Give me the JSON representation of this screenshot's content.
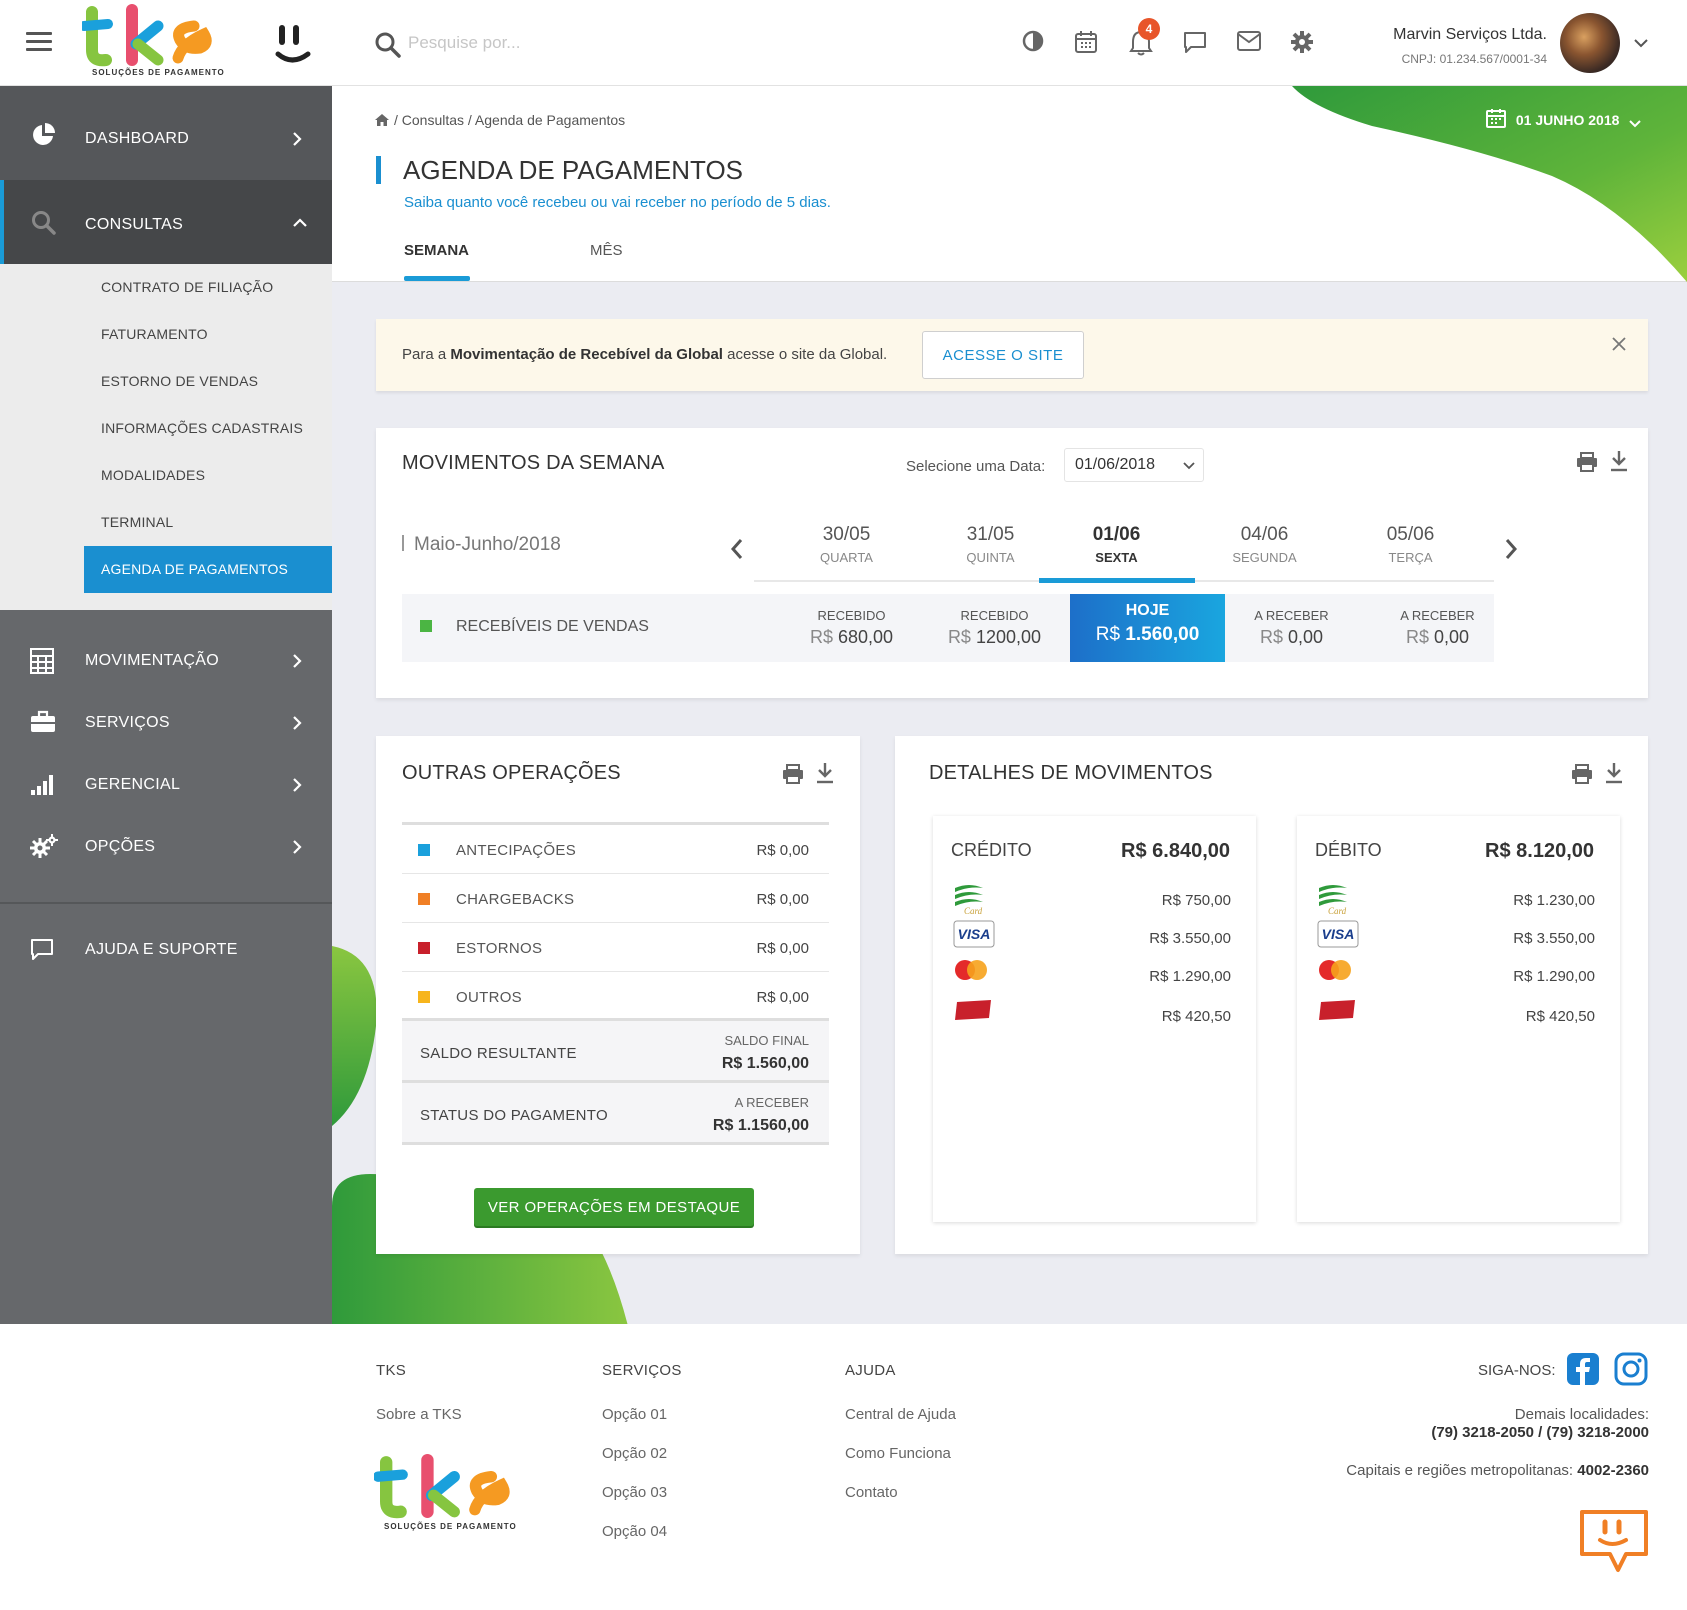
{
  "header": {
    "logo_text": "tks",
    "logo_tagline": "SOLUÇÕES DE PAGAMENTO",
    "search_placeholder": "Pesquise por...",
    "notification_count": "4",
    "user_name": "Marvin Serviços Ltda.",
    "user_cnpj": "CNPJ: 01.234.567/0001-34"
  },
  "sidebar": {
    "dashboard": "DASHBOARD",
    "consultas": "CONSULTAS",
    "submenu": [
      "CONTRATO DE FILIAÇÃO",
      "FATURAMENTO",
      "ESTORNO DE VENDAS",
      "INFORMAÇÕES CADASTRAIS",
      "MODALIDADES",
      "TERMINAL",
      "AGENDA DE PAGAMENTOS"
    ],
    "movimentacao": "MOVIMENTAÇÃO",
    "servicos": "SERVIÇOS",
    "gerencial": "GERENCIAL",
    "opcoes": "OPÇÕES",
    "ajuda": "AJUDA E SUPORTE"
  },
  "page": {
    "breadcrumb": "/ Consultas / Agenda de Pagamentos",
    "date": "01 JUNHO 2018",
    "title": "AGENDA DE PAGAMENTOS",
    "subtitle": "Saiba quanto você recebeu ou vai receber no período de 5 dias.",
    "tabs": [
      "SEMANA",
      "MÊS"
    ]
  },
  "alert": {
    "prefix": "Para a ",
    "bold": "Movimentação de Recebível da Global",
    "suffix": " acesse o site da Global.",
    "button": "ACESSE O SITE"
  },
  "week": {
    "title": "MOVIMENTOS DA SEMANA",
    "select_label": "Selecione uma Data:",
    "select_value": "01/06/2018",
    "period": "Maio-Junho/2018",
    "days": [
      {
        "date": "30/05",
        "name": "QUARTA"
      },
      {
        "date": "31/05",
        "name": "QUINTA"
      },
      {
        "date": "01/06",
        "name": "SEXTA"
      },
      {
        "date": "04/06",
        "name": "SEGUNDA"
      },
      {
        "date": "05/06",
        "name": "TERÇA"
      }
    ],
    "row_label": "RECEBÍVEIS DE VENDAS",
    "currency": "R$",
    "cells": [
      {
        "status": "RECEBIDO",
        "value": "680,00"
      },
      {
        "status": "RECEBIDO",
        "value": "1200,00"
      },
      {
        "status": "HOJE",
        "value": "1.560,00"
      },
      {
        "status": "A RECEBER",
        "value": "0,00"
      },
      {
        "status": "A RECEBER",
        "value": "0,00"
      }
    ]
  },
  "ops": {
    "title": "OUTRAS OPERAÇÕES",
    "rows": [
      {
        "name": "ANTECIPAÇÕES",
        "value": "R$ 0,00",
        "color": "#1aa0dc"
      },
      {
        "name": "CHARGEBACKS",
        "value": "R$ 0,00",
        "color": "#f07f25"
      },
      {
        "name": "ESTORNOS",
        "value": "R$ 0,00",
        "color": "#c8202b"
      },
      {
        "name": "OUTROS",
        "value": "R$ 0,00",
        "color": "#f7b51c"
      }
    ],
    "saldo_label": "SALDO RESULTANTE",
    "saldo_sub": "SALDO FINAL",
    "saldo_value": "R$ 1.560,00",
    "status_label": "STATUS DO PAGAMENTO",
    "status_sub": "A RECEBER",
    "status_value": "R$ 1.1560,00",
    "button": "VER OPERAÇÕES EM DESTAQUE"
  },
  "details": {
    "title": "DETALHES DE MOVIMENTOS",
    "credit": {
      "label": "CRÉDITO",
      "total": "R$ 6.840,00",
      "rows": [
        {
          "brand": "elo-icon",
          "value": "R$ 750,00"
        },
        {
          "brand": "visa-icon",
          "value": "R$ 3.550,00"
        },
        {
          "brand": "mastercard-icon",
          "value": "R$ 1.290,00"
        },
        {
          "brand": "hipercard-icon",
          "value": "R$ 420,50"
        }
      ]
    },
    "debit": {
      "label": "DÉBITO",
      "total": "R$ 8.120,00",
      "rows": [
        {
          "brand": "elo-icon",
          "value": "R$ 1.230,00"
        },
        {
          "brand": "visa-icon",
          "value": "R$ 3.550,00"
        },
        {
          "brand": "mastercard-icon",
          "value": "R$ 1.290,00"
        },
        {
          "brand": "hipercard-icon",
          "value": "R$ 420,50"
        }
      ]
    }
  },
  "footer": {
    "col_tks": {
      "head": "TKS",
      "links": [
        "Sobre a TKS"
      ]
    },
    "col_servicos": {
      "head": "SERVIÇOS",
      "links": [
        "Opção 01",
        "Opção 02",
        "Opção 03",
        "Opção 04"
      ]
    },
    "col_ajuda": {
      "head": "AJUDA",
      "links": [
        "Central de Ajuda",
        "Como Funciona",
        "Contato"
      ]
    },
    "siga": "SIGA-NOS:",
    "demais": "Demais localidades:",
    "demais_phones": "(79) 3218-2050 / (79) 3218-2000",
    "capitais": "Capitais e regiões metropolitanas: ",
    "capitais_phone": "4002-2360",
    "logo_text": "tks",
    "logo_tagline": "SOLUÇÕES DE PAGAMENTO"
  },
  "colors": {
    "primary": "#1a8fd0",
    "accent": "#1a9bd7",
    "green": "#3b9a2f",
    "sidebar": "#66686b"
  }
}
